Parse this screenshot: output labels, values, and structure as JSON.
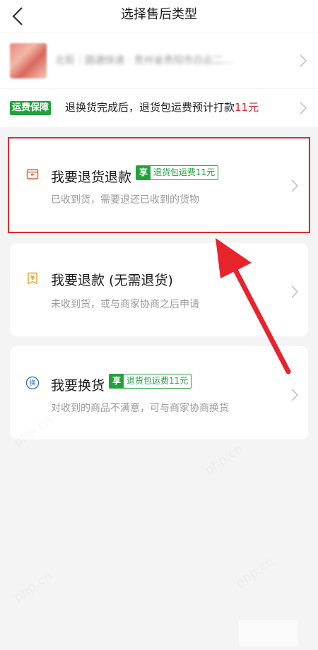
{
  "header": {
    "title": "选择售后类型"
  },
  "product": {
    "info": "北柜｜圆通快递 · 贵州省贵阳市白云二..."
  },
  "freight": {
    "badge": "运费保障",
    "text_before": "退换货完成后，退货包运费预计打款",
    "amount": "11元"
  },
  "options": [
    {
      "title": "我要退货退款",
      "perk_mark": "享",
      "perk_text": "退货包运费11元",
      "subtitle": "已收到货，需要退还已收到的货物"
    },
    {
      "title": "我要退款 (无需退货)",
      "subtitle": "未收到货，或与商家协商之后申请"
    },
    {
      "title": "我要换货",
      "perk_mark": "享",
      "perk_text": "退货包运费11元",
      "subtitle": "对收到的商品不满意，可与商家协商换货"
    }
  ],
  "annotation": {
    "highlight_color": "#e02b2b",
    "arrow_color": "#e8232b"
  },
  "watermark": "php.cn",
  "colors": {
    "green": "#1fa33a",
    "red": "#e0262e",
    "orange": "#f0a020",
    "blue": "#2f6fcf"
  }
}
